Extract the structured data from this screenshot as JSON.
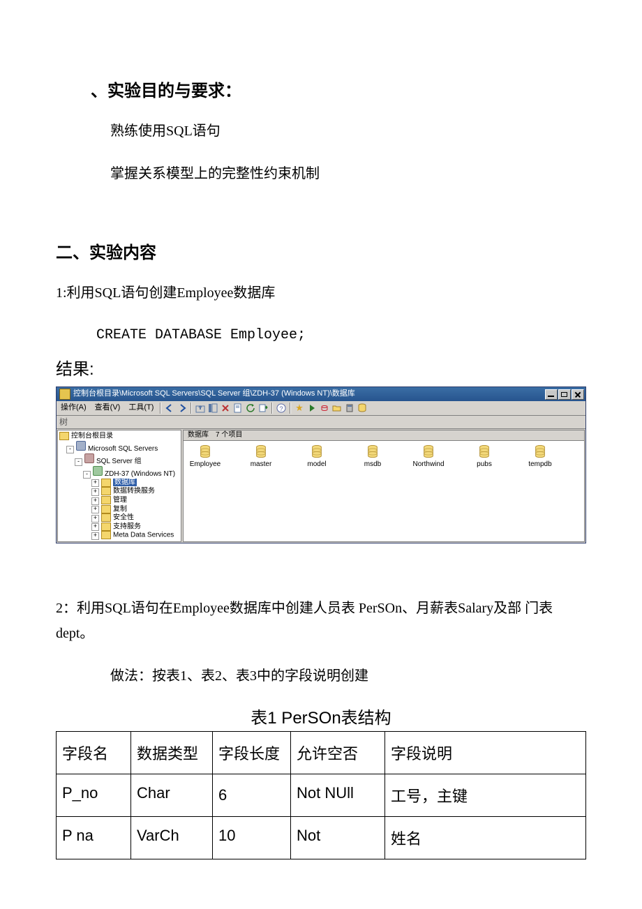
{
  "sections": {
    "s1_title": "、实验目的与要求：",
    "s1_p1": "熟练使用SQL语句",
    "s1_p2": "掌握关系模型上的完整性约束机制",
    "s2_title": "二、实验内容",
    "q1": "1:利用SQL语句创建Employee数据库",
    "q1_code": "CREATE DATABASE Employee;",
    "result_label": "结果:",
    "q2": "2：利用SQL语句在Employee数据库中创建人员表 PerSOn、月薪表Salary及部 门表dept。",
    "q2_note": "做法：按表1、表2、表3中的字段说明创建",
    "table1_title": "表1 PerSOn表结构"
  },
  "screenshot": {
    "title": "控制台根目录\\Microsoft SQL Servers\\SQL Server 组\\ZDH-37 (Windows NT)\\数据库",
    "menus": [
      "操作(A)",
      "查看(V)",
      "工具(T)"
    ],
    "list_header": "数据库　7 个项目",
    "tree": {
      "root": "控制台根目录",
      "n1": "Microsoft SQL Servers",
      "n2": "SQL Server 组",
      "n3": "ZDH-37 (Windows NT)",
      "sel": "数据库",
      "c1": "数据转换服务",
      "c2": "管理",
      "c3": "复制",
      "c4": "安全性",
      "c5": "支持服务",
      "c6": "Meta Data Services"
    },
    "left_handle": "树",
    "dbs": [
      "Employee",
      "master",
      "model",
      "msdb",
      "Northwind",
      "pubs",
      "tempdb"
    ]
  },
  "table1": {
    "header": [
      "字段名",
      "数据类型",
      "字段长度",
      "允许空否",
      "字段说明"
    ],
    "row1": [
      "P_no",
      "Char",
      "6",
      "Not NUll",
      "工号，主键"
    ],
    "row2": [
      "P na",
      "VarCh",
      "10",
      "Not",
      "姓名"
    ]
  }
}
